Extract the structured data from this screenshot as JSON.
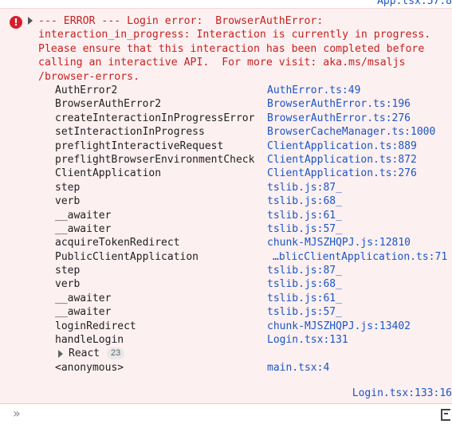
{
  "top_link": "App.tsx:57:8",
  "error": {
    "message": "--- ERROR --- Login error:  BrowserAuthError:\ninteraction_in_progress: Interaction is currently in progress.\nPlease ensure that this interaction has been completed before\ncalling an interactive API.  For more visit: aka.ms/msaljs\n/browser-errors.",
    "stack_before": [
      {
        "fn": "AuthError2",
        "loc": "AuthError.ts:49"
      },
      {
        "fn": "BrowserAuthError2",
        "loc": "BrowserAuthError.ts:196"
      },
      {
        "fn": "createInteractionInProgressError",
        "loc": "BrowserAuthError.ts:276"
      },
      {
        "fn": "setInteractionInProgress",
        "loc": "BrowserCacheManager.ts:1000"
      },
      {
        "fn": "preflightInteractiveRequest",
        "loc": "ClientApplication.ts:889"
      },
      {
        "fn": "preflightBrowserEnvironmentCheck",
        "loc": "ClientApplication.ts:872"
      },
      {
        "fn": "ClientApplication",
        "loc": "ClientApplication.ts:276"
      },
      {
        "fn": "step",
        "loc": "tslib.js:87_"
      },
      {
        "fn": "verb",
        "loc": "tslib.js:68_"
      },
      {
        "fn": "__awaiter",
        "loc": "tslib.js:61_"
      },
      {
        "fn": "__awaiter",
        "loc": "tslib.js:57_"
      },
      {
        "fn": "acquireTokenRedirect",
        "loc": "chunk-MJSZHQPJ.js:12810"
      },
      {
        "fn": "PublicClientApplication",
        "loc": "…blicClientApplication.ts:71"
      },
      {
        "fn": "step",
        "loc": "tslib.js:87_"
      },
      {
        "fn": "verb",
        "loc": "tslib.js:68_"
      },
      {
        "fn": "__awaiter",
        "loc": "tslib.js:61_"
      },
      {
        "fn": "__awaiter",
        "loc": "tslib.js:57_"
      },
      {
        "fn": "loginRedirect",
        "loc": "chunk-MJSZHQPJ.js:13402"
      },
      {
        "fn": "handleLogin",
        "loc": "Login.tsx:131"
      }
    ],
    "group": {
      "label": "React",
      "count": "23"
    },
    "stack_after": [
      {
        "fn": "<anonymous>",
        "loc": "main.tsx:4"
      }
    ],
    "source_link": "Login.tsx:133:16"
  },
  "console_input": {
    "value": "",
    "placeholder": ""
  },
  "icons": {
    "error": "error-circle-icon",
    "expand": "caret-right-icon",
    "prompt": "double-chevron-right-icon",
    "sidebar": "sidebar-toggle-icon"
  },
  "colors": {
    "error_text": "#c5221f",
    "error_bg": "#fdf0f1",
    "link": "#1a56c6",
    "error_icon": "#d81d2a"
  }
}
